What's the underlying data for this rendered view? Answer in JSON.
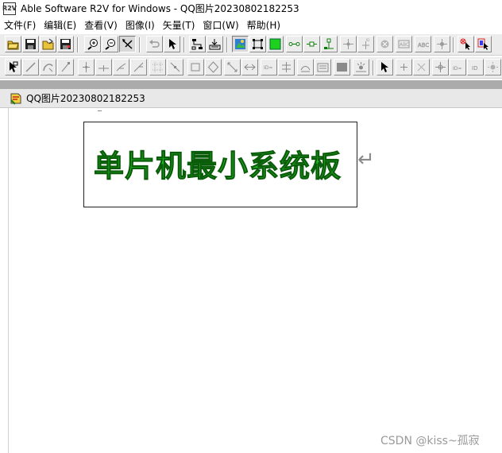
{
  "window": {
    "app_icon_label": "R2V",
    "title": "Able Software R2V for Windows - QQ图片20230802182253"
  },
  "menu": [
    {
      "label": "文件(F)"
    },
    {
      "label": "编辑(E)"
    },
    {
      "label": "查看(V)"
    },
    {
      "label": "图像(I)"
    },
    {
      "label": "矢量(T)"
    },
    {
      "label": "窗口(W)"
    },
    {
      "label": "帮助(H)"
    }
  ],
  "toolbar1": [
    {
      "name": "open-icon"
    },
    {
      "name": "save-icon"
    },
    {
      "name": "open-vector-icon"
    },
    {
      "name": "save-vector-icon"
    },
    {
      "name": "zoom-in-icon"
    },
    {
      "name": "zoom-out-icon"
    },
    {
      "name": "pan-icon"
    },
    {
      "name": "undo-icon"
    },
    {
      "name": "select-arrow-icon"
    },
    {
      "name": "trace-icon"
    },
    {
      "name": "auto-trace-icon"
    },
    {
      "name": "show-image-icon"
    },
    {
      "name": "show-vector-icon"
    },
    {
      "name": "green-fill-icon"
    },
    {
      "name": "node-line-icon"
    },
    {
      "name": "node-point-icon"
    },
    {
      "name": "connect-icon"
    },
    {
      "name": "cross-point-icon"
    },
    {
      "name": "id-point-icon"
    },
    {
      "name": "delete-circle-icon"
    },
    {
      "name": "text-abc-icon"
    },
    {
      "name": "text-abc-outline-icon"
    },
    {
      "name": "star-node-icon"
    },
    {
      "name": "select-red-icon"
    },
    {
      "name": "select-box-red-icon"
    }
  ],
  "toolbar2": [
    {
      "name": "edit-pointer-icon"
    },
    {
      "name": "line-draw-icon"
    },
    {
      "name": "curve-icon"
    },
    {
      "name": "slash-icon"
    },
    {
      "name": "vertex-move-icon"
    },
    {
      "name": "vertex-add-icon"
    },
    {
      "name": "vertex-join-icon"
    },
    {
      "name": "vertex-split-icon"
    },
    {
      "name": "grid-points-icon"
    },
    {
      "name": "line-break-icon"
    },
    {
      "name": "rectangle-icon"
    },
    {
      "name": "diamond-icon"
    },
    {
      "name": "diagonal-icon"
    },
    {
      "name": "arrow-both-icon"
    },
    {
      "name": "id-label-icon"
    },
    {
      "name": "align-icon"
    },
    {
      "name": "scale-icon"
    },
    {
      "name": "book-icon"
    },
    {
      "name": "fill-square-icon"
    },
    {
      "name": "sun-node-icon"
    },
    {
      "name": "select-cursor-icon"
    },
    {
      "name": "plus-node-icon"
    },
    {
      "name": "x-node-icon"
    },
    {
      "name": "cross-arrows-icon"
    },
    {
      "name": "id-marker-icon"
    },
    {
      "name": "text-label-icon"
    },
    {
      "name": "light-icon"
    }
  ],
  "document": {
    "title": "QQ图片20230802182253",
    "image_text": "单片机最小系统板",
    "return_mark": "↵"
  },
  "watermark": "CSDN @kiss~孤寂",
  "colors": {
    "text_green": "#22b522",
    "mdi_background": "#ababab",
    "toolbar_background": "#ececec"
  }
}
